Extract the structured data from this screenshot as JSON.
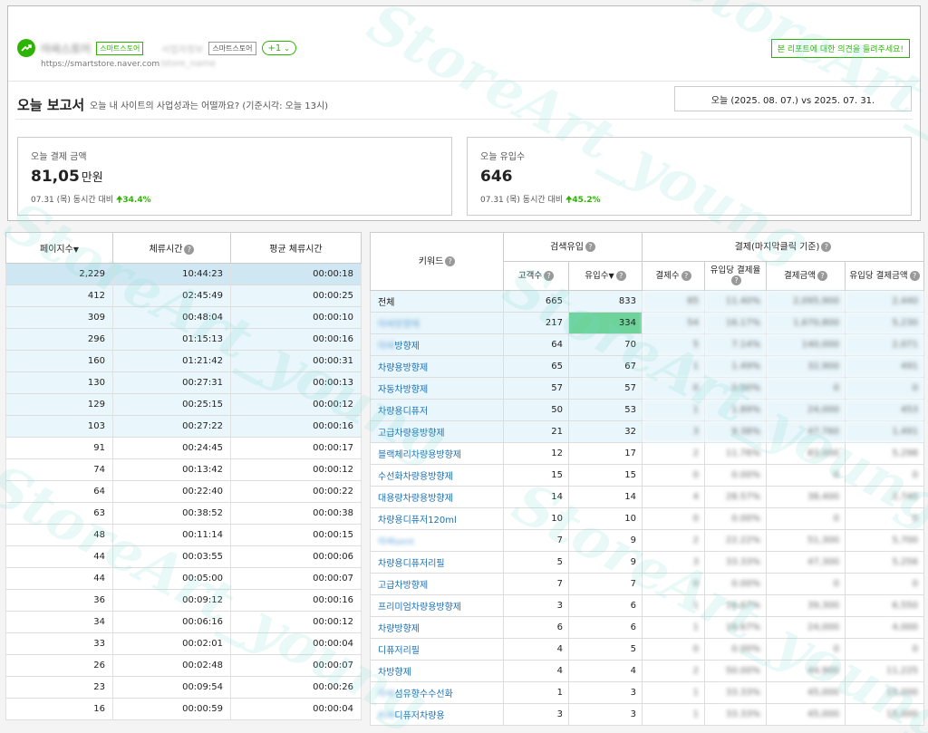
{
  "header": {
    "store_name_blurred": "아싸스토어",
    "tag1": "스마트스토어",
    "store2_blurred": "사업자정보",
    "tag2": "스마트스토어",
    "plus_label": "+1",
    "store_url": "https://smartstore.naver.com",
    "store_url_blurred": "/store_name",
    "feedback_label": "본 리포트에 대한 의견을 들려주세요!"
  },
  "report": {
    "title": "오늘 보고서",
    "subtitle": "오늘 내 사이트의 사업성과는 어떨까요? (기준시각: 오늘 13시)",
    "date_range": "오늘 (2025. 08. 07.) vs 2025. 07. 31."
  },
  "kpis": [
    {
      "label": "오늘 결제 금액",
      "value": "81,05",
      "unit": "만원",
      "compare": "07.31 (목) 동시간 대비",
      "change": "34.4%"
    },
    {
      "label": "오늘 유입수",
      "value": "646",
      "unit": "",
      "compare": "07.31 (목) 동시간 대비",
      "change": "45.2%"
    }
  ],
  "left_table": {
    "headers": [
      "페이지수",
      "체류시간",
      "평균 체류시간"
    ],
    "rows": [
      [
        "2,229",
        "10:44:23",
        "00:00:18"
      ],
      [
        "412",
        "02:45:49",
        "00:00:25"
      ],
      [
        "309",
        "00:48:04",
        "00:00:10"
      ],
      [
        "296",
        "01:15:13",
        "00:00:16"
      ],
      [
        "160",
        "01:21:42",
        "00:00:31"
      ],
      [
        "130",
        "00:27:31",
        "00:00:13"
      ],
      [
        "129",
        "00:25:15",
        "00:00:12"
      ],
      [
        "103",
        "00:27:22",
        "00:00:16"
      ],
      [
        "91",
        "00:24:45",
        "00:00:17"
      ],
      [
        "74",
        "00:13:42",
        "00:00:12"
      ],
      [
        "64",
        "00:22:40",
        "00:00:22"
      ],
      [
        "63",
        "00:38:52",
        "00:00:38"
      ],
      [
        "48",
        "00:11:14",
        "00:00:15"
      ],
      [
        "44",
        "00:03:55",
        "00:00:06"
      ],
      [
        "44",
        "00:05:00",
        "00:00:07"
      ],
      [
        "36",
        "00:09:12",
        "00:00:16"
      ],
      [
        "34",
        "00:06:16",
        "00:00:12"
      ],
      [
        "33",
        "00:02:01",
        "00:00:04"
      ],
      [
        "26",
        "00:02:48",
        "00:00:07"
      ],
      [
        "23",
        "00:09:54",
        "00:00:26"
      ],
      [
        "16",
        "00:00:59",
        "00:00:04"
      ]
    ]
  },
  "right_table": {
    "keyword_header": "키워드",
    "group_search": "검색유입",
    "group_payment": "결제(마지막클릭 기준)",
    "sub_headers": [
      "고객수",
      "유입수",
      "결제수",
      "유입당 결제율",
      "결제금액",
      "유입당 결제금액"
    ],
    "rows": [
      {
        "kw_prefix": "전체",
        "kw": "",
        "c": "665",
        "v": "833",
        "p": [
          "85",
          "11.40%",
          "2,095,900",
          "2,440"
        ]
      },
      {
        "kw_prefix": "",
        "kw_blur": "아싸방향제",
        "kw": "",
        "c": "217",
        "v": "334",
        "p": [
          "54",
          "16.17%",
          "1,670,800",
          "5,230"
        ]
      },
      {
        "kw_prefix": "",
        "kw_blur": "아싸",
        "kw": "방향제",
        "c": "64",
        "v": "70",
        "p": [
          "5",
          "7.14%",
          "140,000",
          "2,071"
        ]
      },
      {
        "kw_prefix": "",
        "kw": "차량용방향제",
        "c": "65",
        "v": "67",
        "p": [
          "1",
          "1.49%",
          "32,900",
          "491"
        ]
      },
      {
        "kw_prefix": "",
        "kw": "자동차방향제",
        "c": "57",
        "v": "57",
        "p": [
          "0",
          "0.00%",
          "0",
          "0"
        ]
      },
      {
        "kw_prefix": "",
        "kw": "차량용디퓨저",
        "c": "50",
        "v": "53",
        "p": [
          "1",
          "1.89%",
          "24,000",
          "453"
        ]
      },
      {
        "kw_prefix": "",
        "kw": "고급차량용방향제",
        "c": "21",
        "v": "32",
        "p": [
          "3",
          "9.38%",
          "47,760",
          "1,491"
        ]
      },
      {
        "kw_prefix": "",
        "kw": "블랙체리차량용방향제",
        "c": "12",
        "v": "17",
        "p": [
          "2",
          "11.76%",
          "83,000",
          "5,298"
        ]
      },
      {
        "kw_prefix": "",
        "kw": "수선화차량용방향제",
        "c": "15",
        "v": "15",
        "p": [
          "0",
          "0.00%",
          "0",
          "0"
        ]
      },
      {
        "kw_prefix": "",
        "kw": "대용량차량용방향제",
        "c": "14",
        "v": "14",
        "p": [
          "4",
          "28.57%",
          "38,400",
          "2,740"
        ]
      },
      {
        "kw_prefix": "",
        "kw": "차량용디퓨저120ml",
        "c": "10",
        "v": "10",
        "p": [
          "0",
          "0.00%",
          "0",
          "0"
        ]
      },
      {
        "kw_prefix": "",
        "kw_blur": "아싸sent",
        "kw": "",
        "c": "7",
        "v": "9",
        "p": [
          "2",
          "22.22%",
          "51,300",
          "5,700"
        ]
      },
      {
        "kw_prefix": "",
        "kw": "차량용디퓨저리필",
        "c": "5",
        "v": "9",
        "p": [
          "3",
          "33.33%",
          "47,300",
          "5,256"
        ]
      },
      {
        "kw_prefix": "",
        "kw": "고급차방향제",
        "c": "7",
        "v": "7",
        "p": [
          "0",
          "0.00%",
          "0",
          "0"
        ]
      },
      {
        "kw_prefix": "",
        "kw": "프리미엄차량용방향제",
        "c": "3",
        "v": "6",
        "p": [
          "1",
          "16.67%",
          "39,300",
          "6,550"
        ]
      },
      {
        "kw_prefix": "",
        "kw": "차량방향제",
        "c": "6",
        "v": "6",
        "p": [
          "1",
          "16.67%",
          "24,000",
          "4,000"
        ]
      },
      {
        "kw_prefix": "",
        "kw": "디퓨저리필",
        "c": "4",
        "v": "5",
        "p": [
          "0",
          "0.00%",
          "0",
          "0"
        ]
      },
      {
        "kw_prefix": "",
        "kw": "차방향제",
        "c": "4",
        "v": "4",
        "p": [
          "2",
          "50.00%",
          "44,900",
          "11,225"
        ]
      },
      {
        "kw_prefix": "",
        "kw_blur": "아싸",
        "kw": "섬유향수수선화",
        "c": "1",
        "v": "3",
        "p": [
          "1",
          "33.33%",
          "45,000",
          "15,000"
        ]
      },
      {
        "kw_prefix": "",
        "kw_blur": "아싸",
        "kw": "디퓨저차량용",
        "c": "3",
        "v": "3",
        "p": [
          "1",
          "33.33%",
          "45,000",
          "15,000"
        ]
      }
    ]
  },
  "watermark": "StoreArt_young",
  "colors": {
    "accent": "#2db400",
    "link": "#1a6fb6",
    "row_highlight": "#e9f6fb",
    "hot_cell": "#6ed39a"
  }
}
